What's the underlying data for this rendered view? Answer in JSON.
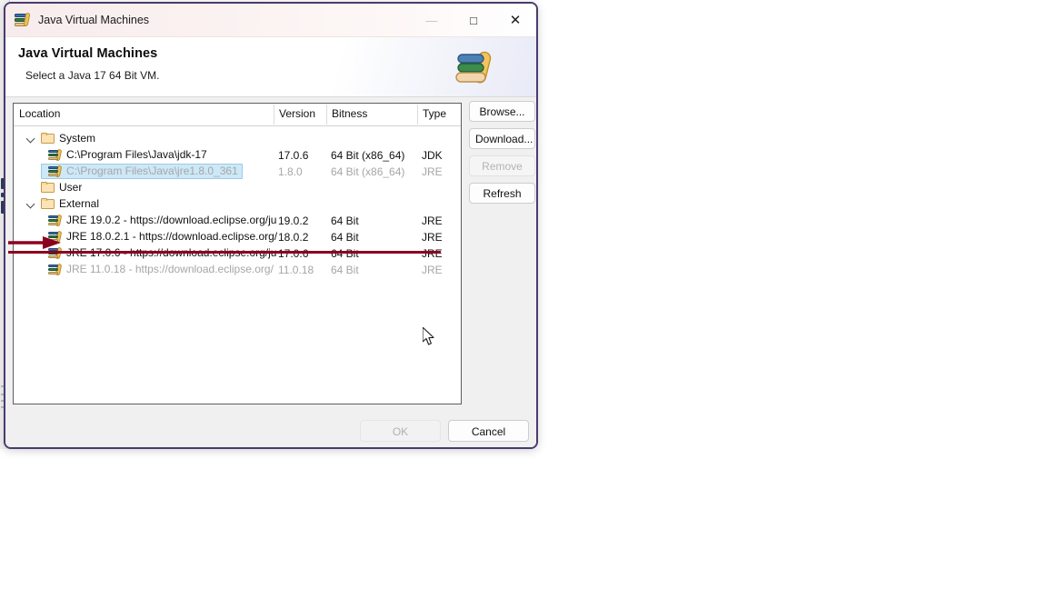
{
  "window": {
    "title": "Java Virtual Machines",
    "title_icon": "java-books-icon",
    "minimize_label": "—",
    "maximize_label": "□",
    "close_label": "✕"
  },
  "banner": {
    "title": "Java Virtual Machines",
    "subtitle": "Select a Java 17 64 Bit VM.",
    "icon": "java-books-icon"
  },
  "table": {
    "columns": [
      "Location",
      "Version",
      "Bitness",
      "Type"
    ],
    "rows": [
      {
        "kind": "group",
        "icon": "folder-icon",
        "twisty": "expanded",
        "location": "System",
        "version": "",
        "bitness": "",
        "type": "",
        "indent": 0,
        "dim": false,
        "selected": false
      },
      {
        "kind": "vm",
        "icon": "java-books-icon",
        "location": "C:\\Program Files\\Java\\jdk-17",
        "version": "17.0.6",
        "bitness": "64 Bit (x86_64)",
        "type": "JDK",
        "indent": 1,
        "dim": false,
        "selected": false
      },
      {
        "kind": "vm",
        "icon": "java-books-icon",
        "location": "C:\\Program Files\\Java\\jre1.8.0_361",
        "version": "1.8.0",
        "bitness": "64 Bit (x86_64)",
        "type": "JRE",
        "indent": 1,
        "dim": true,
        "selected": true
      },
      {
        "kind": "group",
        "icon": "folder-icon",
        "twisty": "none",
        "location": "User",
        "version": "",
        "bitness": "",
        "type": "",
        "indent": 0,
        "dim": false,
        "selected": false
      },
      {
        "kind": "group",
        "icon": "folder-icon",
        "twisty": "expanded",
        "location": "External",
        "version": "",
        "bitness": "",
        "type": "",
        "indent": 0,
        "dim": false,
        "selected": false
      },
      {
        "kind": "vm",
        "icon": "java-books-icon",
        "location": "JRE 19.0.2 - https://download.eclipse.org/ju",
        "version": "19.0.2",
        "bitness": "64 Bit",
        "type": "JRE",
        "indent": 1,
        "dim": false,
        "selected": false
      },
      {
        "kind": "vm",
        "icon": "java-books-icon",
        "location": "JRE 18.0.2.1 - https://download.eclipse.org/",
        "version": "18.0.2",
        "bitness": "64 Bit",
        "type": "JRE",
        "indent": 1,
        "dim": false,
        "selected": false
      },
      {
        "kind": "vm",
        "icon": "java-books-icon",
        "location": "JRE 17.0.6 - https://download.eclipse.org/ju",
        "version": "17.0.6",
        "bitness": "64 Bit",
        "type": "JRE",
        "indent": 1,
        "dim": false,
        "selected": false
      },
      {
        "kind": "vm",
        "icon": "java-books-icon",
        "location": "JRE 11.0.18 - https://download.eclipse.org/",
        "version": "11.0.18",
        "bitness": "64 Bit",
        "type": "JRE",
        "indent": 1,
        "dim": true,
        "selected": false
      }
    ]
  },
  "side_buttons": [
    {
      "label": "Browse...",
      "enabled": true
    },
    {
      "label": "Download...",
      "enabled": true
    },
    {
      "label": "Remove",
      "enabled": false
    },
    {
      "label": "Refresh",
      "enabled": true
    }
  ],
  "bottom_buttons": [
    {
      "label": "OK",
      "enabled": false
    },
    {
      "label": "Cancel",
      "enabled": true
    }
  ],
  "annotation": {
    "color": "#8b0020",
    "arrow": "red-arrow-annotation",
    "underline": "red-underline-annotation",
    "points_at_row": "JRE 17.0.6 - https://download.eclipse.org/ju"
  },
  "colors": {
    "window_border": "#4c3a6e",
    "selection": "#cde8f7",
    "annotation": "#8b0020",
    "dialog_bg": "#f0f0f0"
  }
}
